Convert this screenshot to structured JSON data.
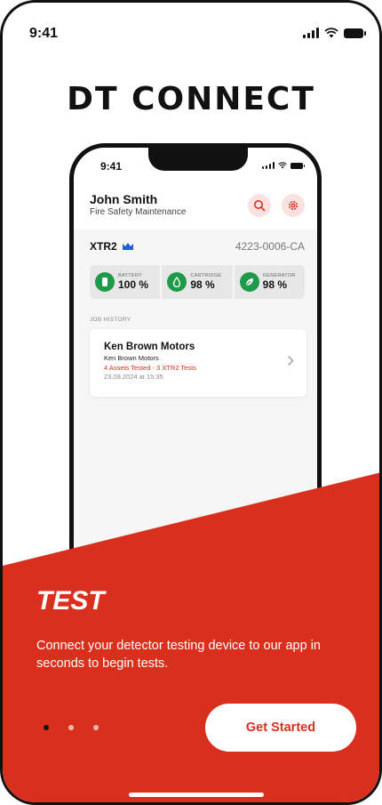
{
  "colors": {
    "accent": "#d9301e",
    "status_green": "#1f9a4a",
    "icon_bg": "#fbe1e0",
    "crown_blue": "#1f5fe0"
  },
  "status_bar": {
    "time": "9:41",
    "icons": [
      "signal-icon",
      "wifi-icon",
      "battery-icon"
    ]
  },
  "app_title": "DT CONNECT",
  "mockup": {
    "status_time": "9:41",
    "user": {
      "name": "John Smith",
      "role": "Fire Safety Maintenance"
    },
    "header_icons": [
      "search-icon",
      "settings-icon"
    ],
    "device": {
      "name": "XTR2",
      "badge_icon": "crown-icon",
      "serial": "4223-0006-CA"
    },
    "stats": [
      {
        "label": "BATTERY",
        "value": "100 %",
        "icon": "battery-level-icon"
      },
      {
        "label": "CARTRIDGE",
        "value": "98 %",
        "icon": "drop-icon"
      },
      {
        "label": "GENERATOR",
        "value": "98 %",
        "icon": "leaf-icon"
      }
    ],
    "job_history_label": "JOB HISTORY",
    "job": {
      "title": "Ken Brown Motors",
      "subtitle": "Ken Brown Motors",
      "tests": "4 Assets Tested - 3 XTR2 Tests",
      "date": "23.09.2024 at 15:35"
    }
  },
  "slide": {
    "title": "TEST",
    "description": "Connect your detector testing device to our app in seconds to begin tests.",
    "page_count": 3,
    "active_page": 1
  },
  "cta_label": "Get Started"
}
